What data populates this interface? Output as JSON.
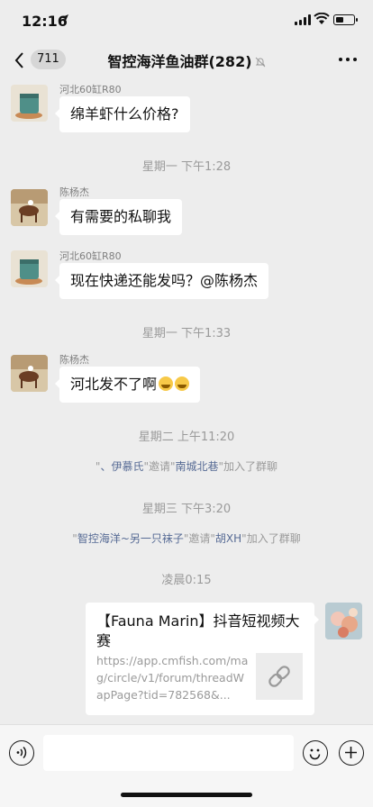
{
  "status": {
    "time": "12:16",
    "location_icon": "location-arrow-icon",
    "battery_level": 0.45
  },
  "nav": {
    "back_icon": "chevron-left-icon",
    "unread_count": "711",
    "title": "智控海洋鱼油群(282)",
    "mute_icon": "bell-muted-icon",
    "more_icon": "ellipsis-icon"
  },
  "messages": [
    {
      "sender": "河北60缸R80",
      "text": "绵羊虾什么价格?"
    },
    {
      "sender": "陈杨杰",
      "text": "有需要的私聊我"
    },
    {
      "sender": "河北60缸R80",
      "text": "现在快递还能发吗？@陈杨杰"
    },
    {
      "sender": "陈杨杰",
      "text": "河北发不了啊"
    }
  ],
  "timestamps": [
    "星期一 下午1:28",
    "星期一 下午1:33",
    "星期二 上午11:20",
    "星期三 下午3:20",
    "凌晨0:15"
  ],
  "system_messages": [
    {
      "prefix": "\"",
      "inviter": "、伊慕氏",
      "mid": "\"邀请\"",
      "invitee": "南城北巷",
      "suffix": "\"加入了群聊"
    },
    {
      "prefix": "\"",
      "inviter": "智控海洋~另一只袜子",
      "mid": "\"邀请\"",
      "invitee": "胡XH",
      "suffix": "\"加入了群聊"
    }
  ],
  "link_card": {
    "title": "【Fauna Marin】抖音短视频大赛",
    "url": "https://app.cmfish.com/mag/circle/v1/forum/threadWapPage?tid=782568&...",
    "thumb_icon": "link-icon"
  },
  "input_bar": {
    "voice_icon": "voice-icon",
    "emoji_icon": "emoji-icon",
    "plus_icon": "plus-icon"
  },
  "colors": {
    "background": "#ededed",
    "bubble": "#ffffff",
    "link_name": "#576b95",
    "meta_text": "#9a9a9a"
  }
}
